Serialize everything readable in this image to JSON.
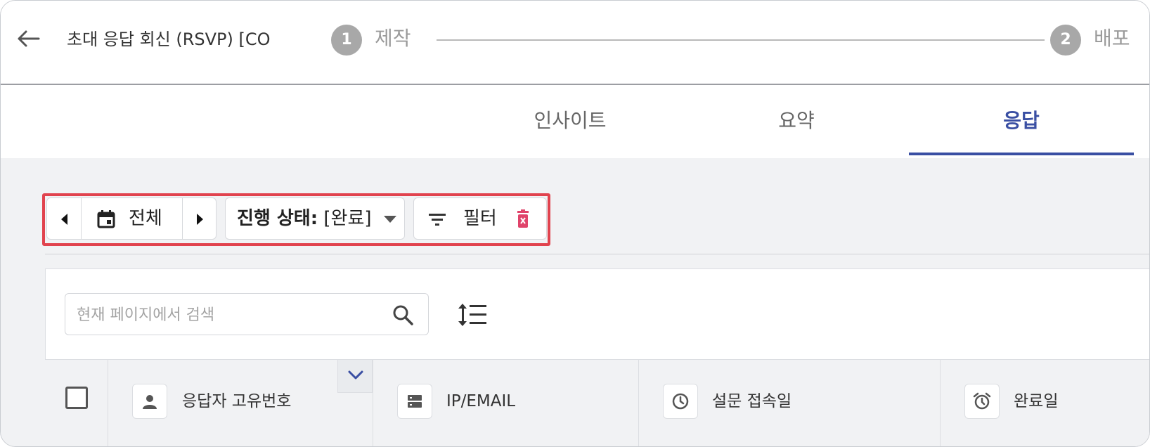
{
  "header": {
    "title": "초대 응답 회신 (RSVP) [CO",
    "steps": [
      {
        "number": "1",
        "label": "제작"
      },
      {
        "number": "2",
        "label": "배포"
      }
    ]
  },
  "tabs": [
    {
      "label": "인사이트",
      "active": false
    },
    {
      "label": "요약",
      "active": false
    },
    {
      "label": "응답",
      "active": true
    }
  ],
  "toolbar": {
    "date_range_label": "전체",
    "status_prefix": "진행 상태:",
    "status_value": "[완료]",
    "filter_label": "필터"
  },
  "search": {
    "placeholder": "현재 페이지에서 검색",
    "value": ""
  },
  "table": {
    "columns": [
      {
        "label": "응답자 고유번호",
        "icon": "person-icon"
      },
      {
        "label": "IP/EMAIL",
        "icon": "server-icon"
      },
      {
        "label": "설문 접속일",
        "icon": "clock-icon"
      },
      {
        "label": "완료일",
        "icon": "alarm-icon"
      }
    ]
  },
  "colors": {
    "accent": "#3a4fa3",
    "highlight_border": "#e1434e",
    "delete_icon": "#e0436a",
    "step_circle": "#a8a8a8"
  }
}
